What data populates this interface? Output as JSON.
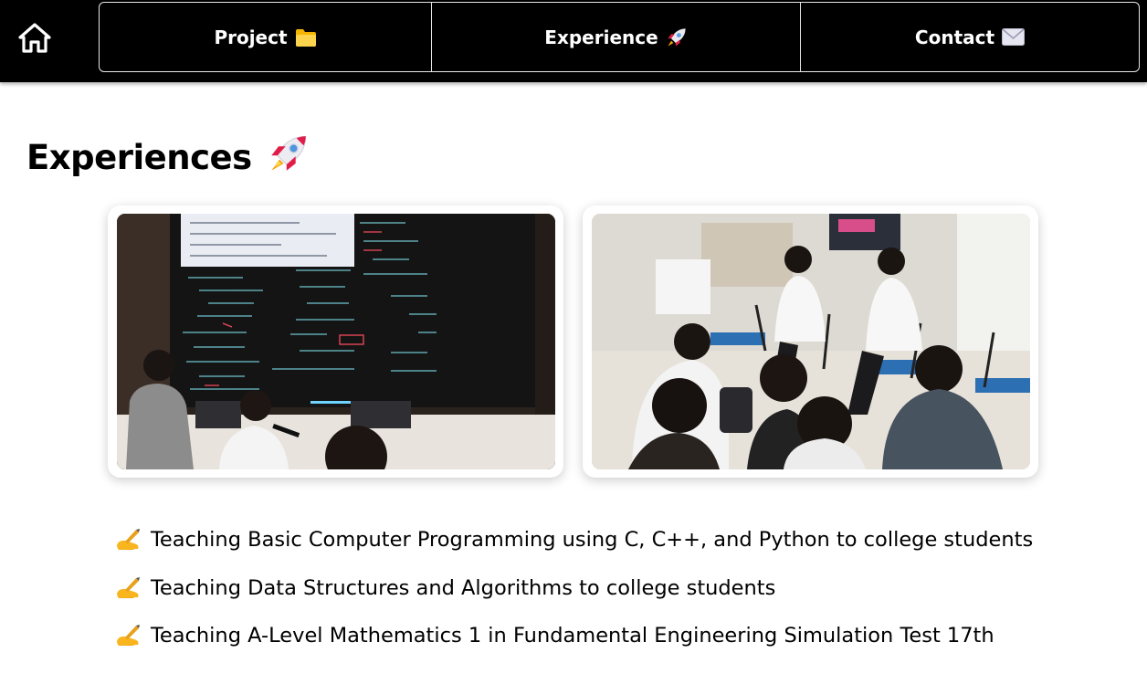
{
  "nav": {
    "home_icon": "home-icon",
    "items": [
      {
        "label": "Project",
        "icon": "folder-emoji-icon"
      },
      {
        "label": "Experience",
        "icon": "rocket-emoji-icon"
      },
      {
        "label": "Contact",
        "icon": "envelope-emoji-icon"
      }
    ]
  },
  "page": {
    "title": "Experiences",
    "title_icon": "rocket-emoji-icon"
  },
  "photos": [
    {
      "description_icon": "photo-lecture-icon"
    },
    {
      "description_icon": "photo-workshop-icon"
    }
  ],
  "experiences": [
    {
      "icon": "writing-hand-icon",
      "text": "Teaching Basic Computer Programming using C, C++, and Python to college students"
    },
    {
      "icon": "writing-hand-icon",
      "text": "Teaching Data Structures and Algorithms to college students"
    },
    {
      "icon": "writing-hand-icon",
      "text": "Teaching A-Level Mathematics 1 in Fundamental Engineering Simulation Test 17th"
    }
  ],
  "colors": {
    "topbar": "#000000",
    "nav_text": "#ffffff",
    "page_bg": "#ffffff",
    "text": "#000000"
  }
}
